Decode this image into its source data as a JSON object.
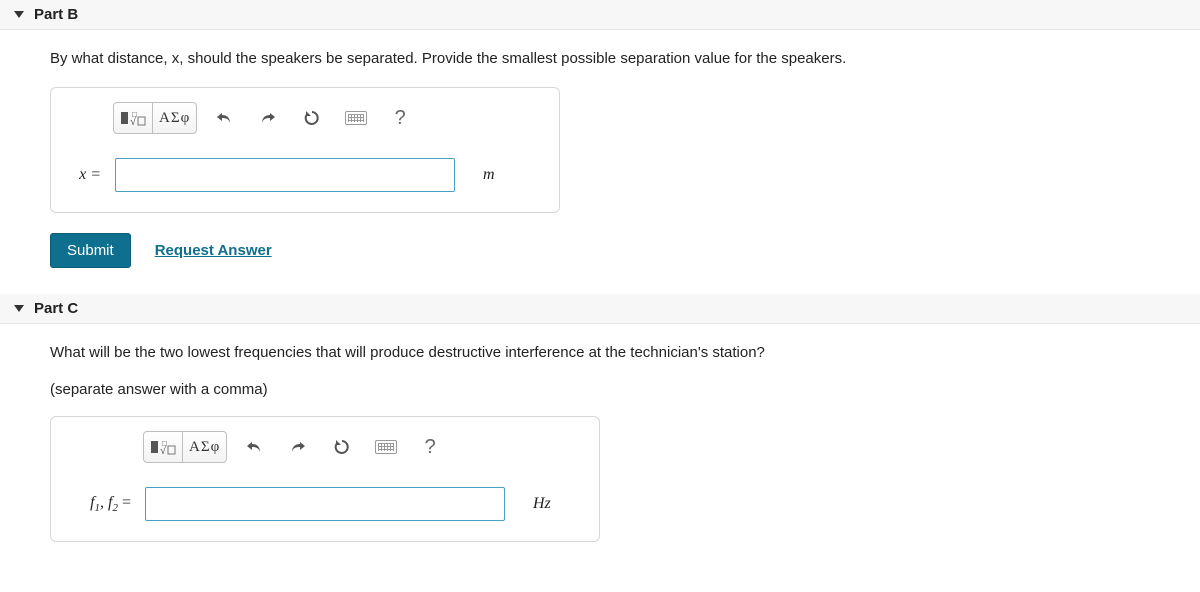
{
  "partB": {
    "title": "Part B",
    "question": "By what distance, x, should the speakers be separated. Provide the smallest possible separation value for the speakers.",
    "toolbar": {
      "greek_label": "ΑΣφ"
    },
    "var_label": "x =",
    "input_value": "",
    "unit": "m",
    "submit_label": "Submit",
    "request_label": "Request Answer"
  },
  "partC": {
    "title": "Part C",
    "question": "What will be the two lowest frequencies that will produce destructive interference at the technician's station?",
    "subnote": "(separate answer with a comma)",
    "toolbar": {
      "greek_label": "ΑΣφ"
    },
    "var_label_html": {
      "prefix": "f",
      "s1": "1",
      "mid": ", f",
      "s2": "2",
      "suffix": " ="
    },
    "input_value": "",
    "unit": "Hz"
  }
}
